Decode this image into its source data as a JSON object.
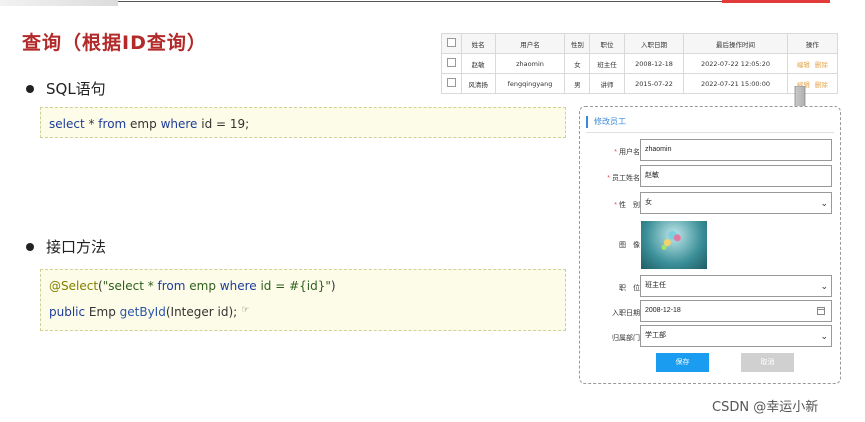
{
  "title": "查询（根据ID查询）",
  "bullets": {
    "sql": "SQL语句",
    "api": "接口方法"
  },
  "code": {
    "sql": {
      "t1": "select",
      "t2": " *  ",
      "t3": "from",
      "t4": " emp ",
      "t5": "where",
      "t6": " id = 19;"
    },
    "api_line1": {
      "t1": "@Select",
      "t2": "(",
      "t3": "\"select * ",
      "t4": "from",
      "t5": " emp ",
      "t6": "where",
      "t7": " id = #{id}\"",
      "t8": ")"
    },
    "api_line2": {
      "t1": "public",
      "t2": " Emp ",
      "t3": "getById",
      "t4": "(Integer id);"
    }
  },
  "table": {
    "headers": [
      "",
      "姓名",
      "用户名",
      "性别",
      "职位",
      "入职日期",
      "最后操作时间",
      "操作"
    ],
    "rows": [
      {
        "name": "赵敏",
        "username": "zhaomin",
        "gender": "女",
        "job": "班主任",
        "entrydate": "2008-12-18",
        "update_time": "2022-07-22 12:05:20",
        "edit": "编辑",
        "del": "删除"
      },
      {
        "name": "风清扬",
        "username": "fengqingyang",
        "gender": "男",
        "job": "讲师",
        "entrydate": "2015-07-22",
        "update_time": "2022-07-21 15:00:00",
        "edit": "编辑",
        "del": "删除"
      }
    ]
  },
  "form": {
    "header": "修改员工",
    "username_label": "用户名",
    "username_value": "zhaomin",
    "name_label": "员工姓名",
    "name_value": "赵敏",
    "gender_label": "性　别",
    "gender_value": "女",
    "image_label": "图　像",
    "job_label": "职　位",
    "job_value": "班主任",
    "entrydate_label": "入职日期",
    "entrydate_value": "2008-12-18",
    "dept_label": "归属部门",
    "dept_value": "学工部",
    "save": "保存",
    "cancel": "取消",
    "required_mark": "*"
  },
  "watermark": "CSDN @幸运小新",
  "colors": {
    "title": "#b22a2a",
    "accent": "#1a9cf0",
    "link": "#e4a54c",
    "code_bg": "#fdfce8"
  }
}
